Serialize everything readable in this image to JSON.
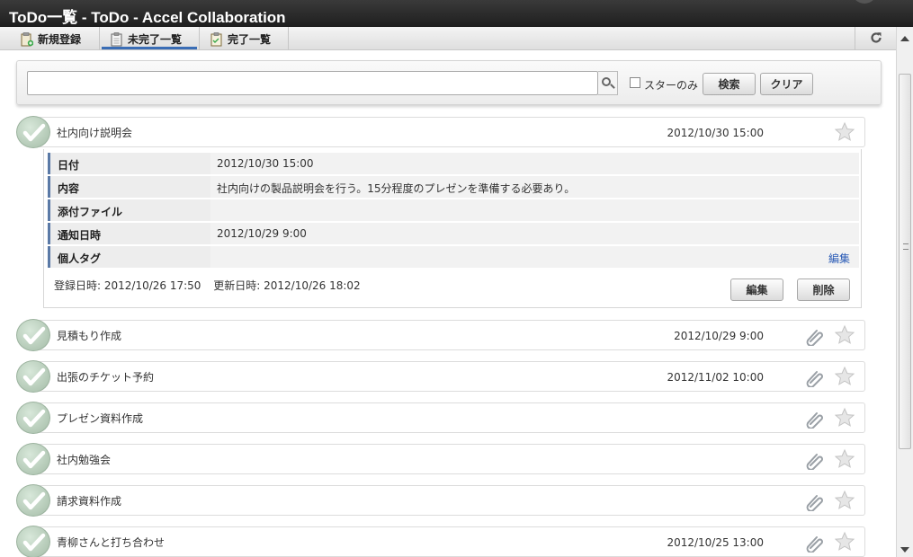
{
  "window": {
    "title": "ToDo一覧 - ToDo - Accel Collaboration"
  },
  "tabs": [
    {
      "label": "新規登録",
      "icon": "clipboard-add-icon",
      "active": false
    },
    {
      "label": "未完了一覧",
      "icon": "clipboard-icon",
      "active": true
    },
    {
      "label": "完了一覧",
      "icon": "clipboard-check-icon",
      "active": false
    }
  ],
  "reload": {
    "icon": "reload-icon"
  },
  "search": {
    "value": "",
    "placeholder": "",
    "star_only_label": "スターのみ",
    "star_only_checked": false,
    "search_button": "検索",
    "clear_button": "クリア"
  },
  "todos": [
    {
      "title": "社内向け説明会",
      "date": "2012/10/30 15:00",
      "attachment": false,
      "starred": false,
      "expanded": true
    },
    {
      "title": "見積もり作成",
      "date": "2012/10/29 9:00",
      "attachment": true,
      "starred": false
    },
    {
      "title": "出張のチケット予約",
      "date": "2012/11/02 10:00",
      "attachment": true,
      "starred": false
    },
    {
      "title": "プレゼン資料作成",
      "date": "",
      "attachment": true,
      "starred": false
    },
    {
      "title": "社内勉強会",
      "date": "",
      "attachment": true,
      "starred": false
    },
    {
      "title": "請求資料作成",
      "date": "",
      "attachment": true,
      "starred": false
    },
    {
      "title": "青柳さんと打ち合わせ",
      "date": "2012/10/25 13:00",
      "attachment": true,
      "starred": false
    }
  ],
  "detail": {
    "fields": [
      {
        "label": "日付",
        "value": "2012/10/30 15:00"
      },
      {
        "label": "内容",
        "value": "社内向けの製品説明会を行う。15分程度のプレゼンを準備する必要あり。"
      },
      {
        "label": "添付ファイル",
        "value": ""
      },
      {
        "label": "通知日時",
        "value": "2012/10/29 9:00"
      },
      {
        "label": "個人タグ",
        "value": "",
        "link": "編集"
      }
    ],
    "created": "登録日時: 2012/10/26 17:50",
    "updated": "更新日時: 2012/10/26 18:02",
    "edit_button": "編集",
    "delete_button": "削除"
  },
  "colors": {
    "accent": "#3a6db5",
    "link": "#2a5bb6",
    "check": "#a4bca7"
  }
}
